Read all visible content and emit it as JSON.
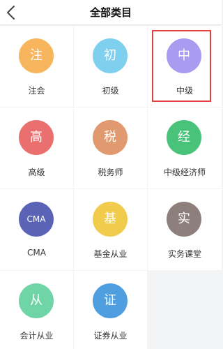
{
  "header": {
    "title": "全部类目",
    "back_icon": "chevron-left-icon"
  },
  "categories": [
    {
      "icon_text": "注",
      "label": "注会",
      "color": "#f7b55e"
    },
    {
      "icon_text": "初",
      "label": "初级",
      "color": "#7fd0ef"
    },
    {
      "icon_text": "中",
      "label": "中级",
      "color": "#a99bf0",
      "selected": true
    },
    {
      "icon_text": "高",
      "label": "高级",
      "color": "#ea7070"
    },
    {
      "icon_text": "税",
      "label": "税务师",
      "color": "#e1996f"
    },
    {
      "icon_text": "经",
      "label": "中级经济师",
      "color": "#49c37a"
    },
    {
      "icon_text": "CMA",
      "label": "CMA",
      "color": "#5a63b5"
    },
    {
      "icon_text": "基",
      "label": "基金从业",
      "color": "#f0cb4c"
    },
    {
      "icon_text": "实",
      "label": "实务课堂",
      "color": "#8d7f7b"
    },
    {
      "icon_text": "从",
      "label": "会计从业",
      "color": "#6fd4a6"
    },
    {
      "icon_text": "证",
      "label": "证券从业",
      "color": "#4f9ee0"
    }
  ],
  "selection_color": "#e0403f"
}
